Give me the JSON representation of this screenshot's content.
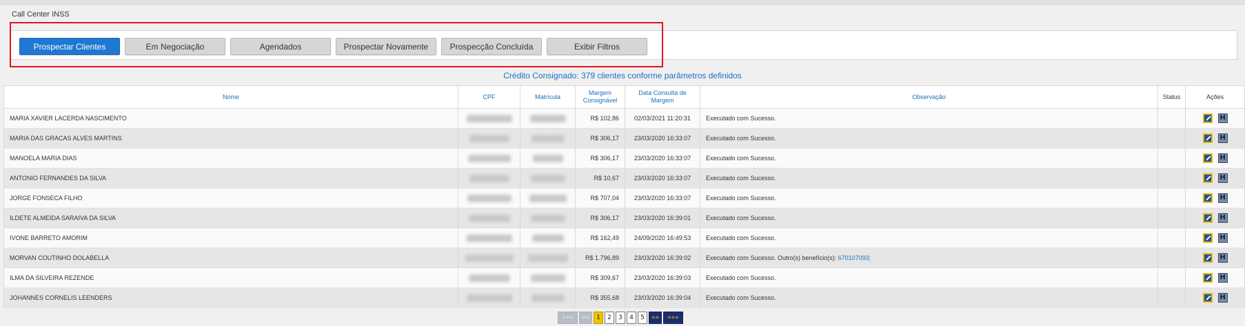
{
  "app": {
    "title": "Call Center INSS"
  },
  "tabs": [
    {
      "label": "Prospectar Clientes",
      "active": true
    },
    {
      "label": "Em Negociação",
      "active": false
    },
    {
      "label": "Agendados",
      "active": false
    },
    {
      "label": "Prospectar Novamente",
      "active": false
    },
    {
      "label": "Prospecção Concluída",
      "active": false
    },
    {
      "label": "Exibir Filtros",
      "active": false
    }
  ],
  "summary": "Crédito Consignado: 379 clientes conforme parâmetros definidos",
  "table": {
    "headers": {
      "nome": "Nome",
      "cpf": "CPF",
      "matricula": "Matrícula",
      "margem": "Margem Consignável",
      "data": "Data Consulta de Margem",
      "observacao": "Observação",
      "status": "Status",
      "acoes": "Ações"
    },
    "rows": [
      {
        "nome": "MARIA XAVIER LACERDA NASCIMENTO",
        "margem": "R$ 102,86",
        "data": "02/03/2021 11:20:31",
        "obs": "Executado com Sucesso.",
        "obs_link": ""
      },
      {
        "nome": "MARIA DAS GRACAS ALVES MARTINS",
        "margem": "R$ 306,17",
        "data": "23/03/2020 16:33:07",
        "obs": "Executado com Sucesso.",
        "obs_link": ""
      },
      {
        "nome": "MANOELA MARIA DIAS",
        "margem": "R$ 306,17",
        "data": "23/03/2020 16:33:07",
        "obs": "Executado com Sucesso.",
        "obs_link": ""
      },
      {
        "nome": "ANTONIO FERNANDES DA SILVA",
        "margem": "R$ 10,67",
        "data": "23/03/2020 16:33:07",
        "obs": "Executado com Sucesso.",
        "obs_link": ""
      },
      {
        "nome": "JORGE FONSECA FILHO",
        "margem": "R$ 707,04",
        "data": "23/03/2020 16:33:07",
        "obs": "Executado com Sucesso.",
        "obs_link": ""
      },
      {
        "nome": "ILDETE ALMEIDA SARAIVA DA SILVA",
        "margem": "R$ 306,17",
        "data": "23/03/2020 16:39:01",
        "obs": "Executado com Sucesso.",
        "obs_link": ""
      },
      {
        "nome": "IVONE BARRETO AMORIM",
        "margem": "R$ 162,49",
        "data": "24/09/2020 16:49:53",
        "obs": "Executado com Sucesso.",
        "obs_link": ""
      },
      {
        "nome": "MORVAN COUTINHO DOLABELLA",
        "margem": "R$ 1.796,89",
        "data": "23/03/2020 16:39:02",
        "obs": "Executado com Sucesso. Outro(s) benefício(s):",
        "obs_link": "670107093;"
      },
      {
        "nome": "ILMA DA SILVEIRA REZENDE",
        "margem": "R$ 309,67",
        "data": "23/03/2020 16:39:03",
        "obs": "Executado com Sucesso.",
        "obs_link": ""
      },
      {
        "nome": "JOHANNES CORNELIS LEENDERS",
        "margem": "R$ 355,68",
        "data": "23/03/2020 16:39:04",
        "obs": "Executado com Sucesso.",
        "obs_link": ""
      }
    ],
    "row_icons": [
      "edit-icon",
      "history-icon"
    ],
    "history_icon_glyph": "H"
  },
  "pagination": {
    "first": "«««",
    "prev": "««",
    "pages": [
      "1",
      "2",
      "3",
      "4",
      "5"
    ],
    "current": "1",
    "next": "»»",
    "last": "»»»"
  },
  "colors": {
    "accent": "#1f78d1",
    "highlight_box": "#e0141e",
    "pager_current": "#f0c400",
    "pager_nav": "#1c2c6e"
  }
}
